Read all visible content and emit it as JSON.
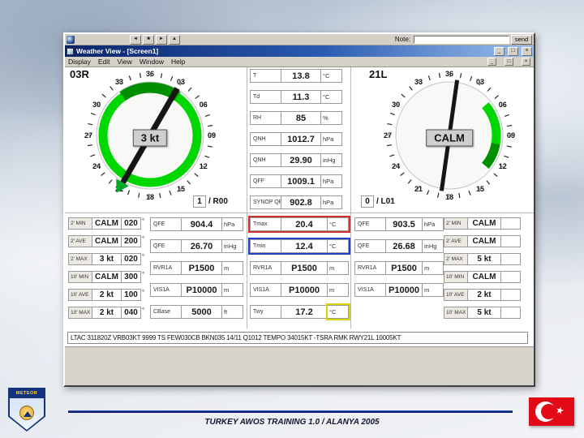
{
  "slide": {
    "footer": "TURKEY AWOS TRAINING 1.0 / ALANYA 2005",
    "logo_text": "METEOR"
  },
  "app": {
    "toolbar_buttons": [
      "◄",
      "■",
      "►",
      "▲"
    ],
    "note_label": "Note:",
    "note_value": "",
    "send_label": "send",
    "title": "Weather View - [Screen1]",
    "menus": [
      "Display",
      "Edit",
      "View",
      "Window",
      "Help"
    ],
    "window_buttons": [
      "_",
      "□",
      "×"
    ]
  },
  "left": {
    "runway": "03R",
    "speed": "3 kt",
    "needle_deg": 30,
    "compass_labels": [
      "36",
      "03",
      "06",
      "09",
      "12",
      "15",
      "18",
      "21",
      "24",
      "27",
      "30",
      "33"
    ],
    "selector": {
      "value": "1",
      "label": "/ R00"
    },
    "wind": [
      {
        "label": "2' MIN",
        "speed": "CALM",
        "dir": "020",
        "unit": "°"
      },
      {
        "label": "2' AVE",
        "speed": "CALM",
        "dir": "200",
        "unit": "°"
      },
      {
        "label": "2' MAX",
        "speed": "3 kt",
        "dir": "020",
        "unit": "°"
      },
      {
        "label": "10' MIN",
        "speed": "CALM",
        "dir": "300",
        "unit": "°"
      },
      {
        "label": "10' AVE",
        "speed": "2 kt",
        "dir": "100",
        "unit": "°"
      },
      {
        "label": "10' MAX",
        "speed": "2 kt",
        "dir": "040",
        "unit": "°"
      }
    ],
    "readouts": [
      {
        "label": "QFE",
        "value": "904.4",
        "unit": "hPa"
      },
      {
        "label": "QFE",
        "value": "26.70",
        "unit": "inHg"
      },
      {
        "label": "RVR1A",
        "value": "P1500",
        "unit": "m"
      },
      {
        "label": "VIS1A",
        "value": "P10000",
        "unit": "m"
      },
      {
        "label": "CBase",
        "value": "5000",
        "unit": "ft"
      }
    ]
  },
  "center": {
    "readouts": [
      {
        "label": "T",
        "value": "13.8",
        "unit": "°C"
      },
      {
        "label": "Td",
        "value": "11.3",
        "unit": "°C"
      },
      {
        "label": "RH",
        "value": "85",
        "unit": "%"
      },
      {
        "label": "QNH",
        "value": "1012.7",
        "unit": "hPa"
      },
      {
        "label": "QNH",
        "value": "29.90",
        "unit": "inHg"
      },
      {
        "label": "QFF",
        "value": "1009.1",
        "unit": "hPa"
      },
      {
        "label": "SYNOP QFE",
        "value": "902.8",
        "unit": "hPa"
      }
    ],
    "extremes": [
      {
        "label": "Tmax",
        "value": "20.4",
        "unit": "°C",
        "style": "red"
      },
      {
        "label": "Tmin",
        "value": "12.4",
        "unit": "°C",
        "style": "blue"
      },
      {
        "label": "RVR1A",
        "value": "P1500",
        "unit": "m",
        "style": "plain"
      },
      {
        "label": "VIS1A",
        "value": "P10000",
        "unit": "m",
        "style": "plain"
      },
      {
        "label": "Twy",
        "value": "17.2",
        "unit": "°C",
        "style": "yellow"
      }
    ]
  },
  "right": {
    "runway": "21L",
    "speed": "CALM",
    "needle_deg": 8,
    "compass_labels": [
      "36",
      "03",
      "06",
      "09",
      "12",
      "15",
      "18",
      "21",
      "24",
      "27",
      "30",
      "33"
    ],
    "selector": {
      "value": "0",
      "label": "/ L01"
    },
    "wind": [
      {
        "label": "2' MIN",
        "speed": "CALM",
        "dir": "",
        "unit": ""
      },
      {
        "label": "2' AVE",
        "speed": "CALM",
        "dir": "",
        "unit": ""
      },
      {
        "label": "2' MAX",
        "speed": "5 kt",
        "dir": "",
        "unit": ""
      },
      {
        "label": "10' MIN",
        "speed": "CALM",
        "dir": "",
        "unit": ""
      },
      {
        "label": "10' AVE",
        "speed": "2 kt",
        "dir": "",
        "unit": ""
      },
      {
        "label": "10' MAX",
        "speed": "5 kt",
        "dir": "",
        "unit": ""
      }
    ],
    "readouts": [
      {
        "label": "QFE",
        "value": "903.5",
        "unit": "hPa"
      },
      {
        "label": "QFE",
        "value": "26.68",
        "unit": "inHg"
      },
      {
        "label": "RVR1A",
        "value": "P1500",
        "unit": "m"
      },
      {
        "label": "VIS1A",
        "value": "P10000",
        "unit": "m"
      }
    ]
  },
  "metar": "LTAC 311820Z VRB03KT 9999 TS FEW030CB BKN035 14/11 Q1012 TEMPO 34015KT -TSRA RMK RWY21L 10005KT",
  "colors": {
    "ring_green": "#00d600",
    "dark_green": "#008f00",
    "titlebar_blue": "#0a246a",
    "alarm_red": "#d03030",
    "alarm_blue": "#2040c8",
    "alarm_yellow": "#dcd200",
    "flag_red": "#e30a17"
  }
}
